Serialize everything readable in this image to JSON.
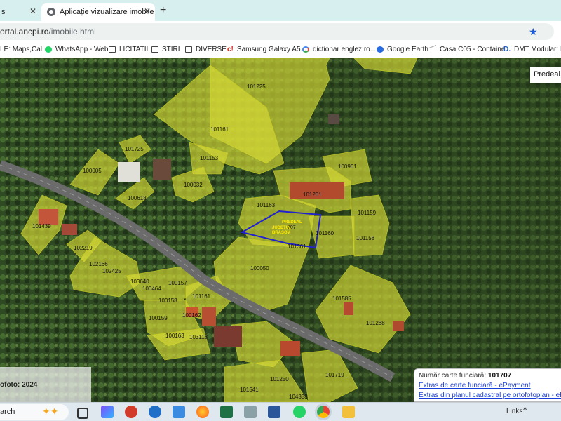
{
  "tabs": [
    {
      "label": "s",
      "active": false
    },
    {
      "label": "Aplicație vizualizare imobile",
      "active": true
    }
  ],
  "tab_close": "✕",
  "new_tab": "+",
  "address": {
    "prefix": "ortal.ancpi.ro",
    "path": "/imobile.html"
  },
  "bookmarks": [
    {
      "label": "LE: Maps,Cal...",
      "icon": "none"
    },
    {
      "label": "WhatsApp - Web",
      "icon": "whatsapp-icon"
    },
    {
      "label": "LICITATII",
      "icon": "folder-icon"
    },
    {
      "label": "STIRI",
      "icon": "folder-icon"
    },
    {
      "label": "DIVERSE",
      "icon": "folder-icon"
    },
    {
      "label": "Samsung Galaxy A5...",
      "icon": "c-icon"
    },
    {
      "label": "dictionar englez ro...",
      "icon": "google-icon"
    },
    {
      "label": "Google Earth",
      "icon": "google-earth-icon"
    },
    {
      "label": "Casa C05 - Containe...",
      "icon": "casa-icon"
    },
    {
      "label": "DMT Modular: Des",
      "icon": "d-icon"
    }
  ],
  "map": {
    "search_chip": "Predeal,",
    "selected_parcel": {
      "line1": "PREDEAL",
      "line2": "JUDEȚUL",
      "line3": "BRAȘOV",
      "number_fragment": "707"
    },
    "parcels": [
      "101225",
      "101161",
      "101725",
      "101153",
      "100005",
      "100032",
      "100961",
      "101201",
      "100618",
      "101163",
      "101159",
      "101439",
      "101160",
      "101158",
      "101361",
      "102219",
      "102166",
      "100050",
      "102425",
      "100157",
      "103640",
      "100464",
      "101161",
      "101585",
      "100158",
      "100162",
      "101288",
      "100159",
      "100163",
      "103118",
      "101541",
      "101250",
      "101719",
      "104338"
    ],
    "orthophoto_label": "ofoto: 2024",
    "info": {
      "label": "Număr carte funciară:",
      "value": "101707",
      "link1": "Extras de carte funciară - ePayment",
      "link2": "Extras din planul cadastral pe ortofotoplan - eP"
    }
  },
  "taskbar": {
    "search": "arch",
    "links": "Links",
    "tray_chevron": "^"
  },
  "colors": {
    "parcel_fill": "#d9dc3a",
    "selected_outline": "#2020d0",
    "label_yellow": "#ffea00"
  }
}
